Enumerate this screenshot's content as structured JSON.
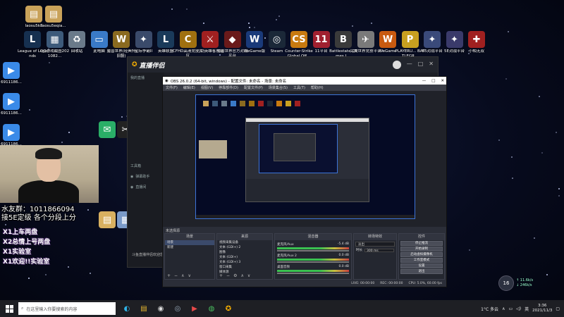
{
  "colors": {
    "accent": "#3c73d8",
    "obs_bg": "#2b2e38",
    "desktop": "#070b1e"
  },
  "desktop_icons_row1": [
    {
      "label": "laosu5k8",
      "icon": "folder-icon",
      "color": "#c9a25a",
      "glyph": "▤"
    },
    {
      "label": "laosu5eqia...",
      "icon": "folder-icon",
      "color": "#c9a25a",
      "glyph": "▤"
    }
  ],
  "desktop_icons_row2": [
    {
      "label": "League of Legends",
      "icon": "lol-icon",
      "color": "#163050",
      "glyph": "L"
    },
    {
      "label": "QQ游戏截图2021082...",
      "icon": "image-icon",
      "color": "#3d5a7a",
      "glyph": "▦"
    },
    {
      "label": "回收站",
      "icon": "recycle-bin-icon",
      "color": "#6a7a8a",
      "glyph": "♻"
    },
    {
      "label": "此电脑",
      "icon": "computer-icon",
      "color": "#3a7ac8",
      "glyph": "▭"
    },
    {
      "label": "魔兽世界(经典怀旧服)",
      "icon": "wow-icon",
      "color": "#8a6a20",
      "glyph": "W"
    },
    {
      "label": "星际争霸II",
      "icon": "sc2-icon",
      "color": "#3a4a6a",
      "glyph": "✦"
    },
    {
      "label": "英雄联盟",
      "icon": "lol-icon",
      "color": "#1a3a5a",
      "glyph": "L"
    },
    {
      "label": "CFHD高清竞技大区",
      "icon": "cf-icon",
      "color": "#a07010",
      "glyph": "C"
    },
    {
      "label": "刀剑英雄客户端",
      "icon": "game-icon",
      "color": "#a02020",
      "glyph": "⚔"
    },
    {
      "label": "魔兽世界官方对战平台",
      "icon": "game-icon",
      "color": "#6a1a1a",
      "glyph": "◆"
    },
    {
      "label": "WeGame版",
      "icon": "wegame-icon",
      "color": "#1a3a7a",
      "glyph": "W"
    },
    {
      "label": "Steam",
      "icon": "steam-icon",
      "color": "#1b2838",
      "glyph": "◎"
    },
    {
      "label": "Counter-Strike Global Off...",
      "icon": "csgo-icon",
      "color": "#c87a10",
      "glyph": "CS"
    },
    {
      "label": "11平台",
      "icon": "game-icon",
      "color": "#a02030",
      "glyph": "11"
    },
    {
      "label": "Battlestate Games L...",
      "icon": "game-icon",
      "color": "#3a3a3a",
      "glyph": "B"
    },
    {
      "label": "完美世界竞技平台",
      "icon": "game-icon",
      "color": "#7a7a7a",
      "glyph": "✈"
    },
    {
      "label": "WeGame",
      "icon": "wegame-icon",
      "color": "#c85a10",
      "glyph": "W"
    },
    {
      "label": "PLAYERU... BATTLEGR...",
      "icon": "pubg-icon",
      "color": "#c8a020",
      "glyph": "P"
    },
    {
      "label": "B5对战平台",
      "icon": "game-icon",
      "color": "#3a4a7a",
      "glyph": "✦"
    },
    {
      "label": "5E对战平台",
      "icon": "game-icon",
      "color": "#3a3a6a",
      "glyph": "✦"
    },
    {
      "label": "小帕无双",
      "icon": "game-icon",
      "color": "#a02020",
      "glyph": "✚"
    }
  ],
  "left_files": [
    {
      "label": "6911186...",
      "icon": "video-icon"
    },
    {
      "label": "6911186...",
      "icon": "video-icon"
    },
    {
      "label": "6911186...",
      "icon": "video-icon"
    }
  ],
  "assistant": {
    "title": "直播伴侣",
    "left_items": [
      "我的直播",
      "工具箱",
      "弹幕助手",
      "直播间"
    ],
    "bottom_text": "斗鱼直播伴侣欢迎您"
  },
  "obs": {
    "title": "OBS 26.0.2 (64-bit, windows) - 配置文件: 未命名 - 场景: 未命名",
    "menu": [
      "文件(F)",
      "编辑(E)",
      "视图(V)",
      "停靠部件(D)",
      "配置文件(P)",
      "场景集合(S)",
      "工具(T)",
      "帮助(H)"
    ],
    "scene_bar": "未选择源",
    "scenes_header": "场景",
    "scenes": [
      "场景",
      "新建"
    ],
    "sources_header": "来源",
    "sources": [
      "视频采集设备",
      "文本 (GDI+) 2",
      "图像",
      "文本 (GDI+)",
      "文本 (GDI+) 3",
      "窗口采集",
      "媒体源"
    ],
    "mixer_header": "混音器",
    "mixer": [
      {
        "name": "麦克风/Aux",
        "db": "-5.4 dB"
      },
      {
        "name": "麦克风/Aux 2",
        "db": "0.0 dB"
      },
      {
        "name": "桌面音频",
        "db": "0.0 dB"
      }
    ],
    "transition_header": "转场特效",
    "transition_value": "淡出",
    "duration_label": "时长",
    "duration_value": "300 ms",
    "controls_header": "控件",
    "controls": [
      "停止推流",
      "开始录制",
      "启动虚拟摄像机",
      "工作室模式",
      "设置",
      "退出"
    ],
    "status": [
      "LIVE: 00:00:00",
      "REC: 00:00:00",
      "CPU: 5.0%, 60.00 fps"
    ]
  },
  "overlay": {
    "line1": "水友群：1011866094",
    "line2": "接5E定级 各个分段上分",
    "chat": [
      "X1上车两盘",
      "X2总情上号两盘",
      "X1实验室",
      "X1欢迎!!实验室"
    ]
  },
  "taskbar": {
    "search_placeholder": "在这里输入你要搜索的内容",
    "apps": [
      "edge-icon",
      "file-explorer-icon",
      "obs-icon",
      "steam-icon",
      "live-icon",
      "chrome-icon",
      "assistant-icon"
    ],
    "weather": "1°C 多云",
    "time": "3:36",
    "date": "2021/11/3",
    "ime": "英"
  },
  "net_widget": {
    "percent": "16",
    "up": "↑ 11.6k/s",
    "down": "↓ 246k/s"
  }
}
